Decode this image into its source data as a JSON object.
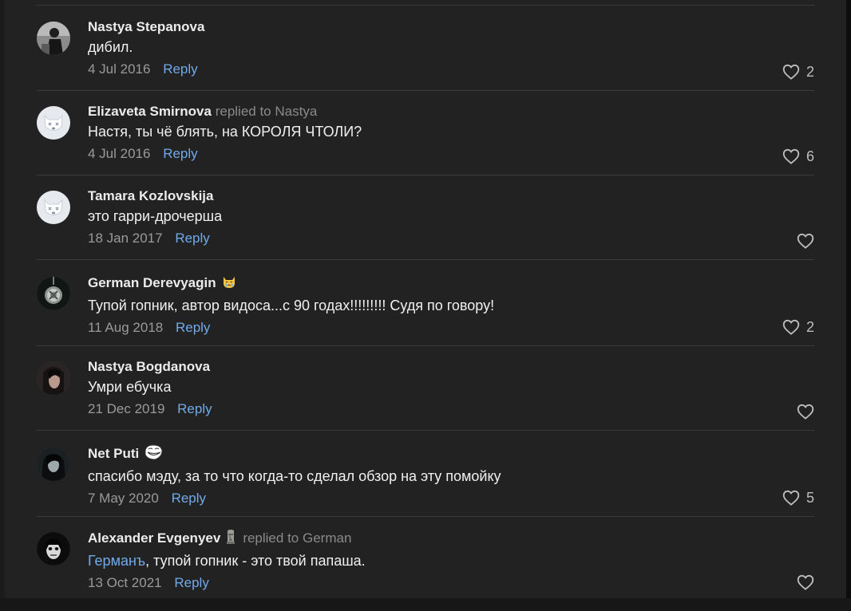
{
  "comments": [
    {
      "author": "Nastya Stepanova",
      "replied_label": "",
      "replied_to": "",
      "mention": "",
      "text": "дибил.",
      "date": "4 Jul 2016",
      "reply_label": "Reply",
      "likes": "2",
      "avatar_icon": "photo"
    },
    {
      "author": "Elizaveta Smirnova",
      "replied_label": "replied to",
      "replied_to": "Nastya",
      "mention": "",
      "text": "Настя, ты чё блять, на КОРОЛЯ ЧТОЛИ?",
      "date": "4 Jul 2016",
      "reply_label": "Reply",
      "likes": "6",
      "avatar_icon": "deactivated-dog"
    },
    {
      "author": "Tamara Kozlovskija",
      "replied_label": "",
      "replied_to": "",
      "mention": "",
      "text": "это гарри-дрочерша",
      "date": "18 Jan 2017",
      "reply_label": "Reply",
      "likes": "",
      "avatar_icon": "deactivated-dog"
    },
    {
      "author": "German Derevyagin",
      "replied_label": "",
      "replied_to": "",
      "mention": "",
      "text": "Тупой гопник, автор видоса...с 90 годах!!!!!!!!! Судя по говору!",
      "date": "11 Aug 2018",
      "reply_label": "Reply",
      "likes": "2",
      "avatar_icon": "pendant-photo",
      "badge": "crying-cat-emoji"
    },
    {
      "author": "Nastya Bogdanova",
      "replied_label": "",
      "replied_to": "",
      "mention": "",
      "text": "Умри ебучка",
      "date": "21 Dec 2019",
      "reply_label": "Reply",
      "likes": "",
      "avatar_icon": "photo"
    },
    {
      "author": "Net Puti",
      "replied_label": "",
      "replied_to": "",
      "mention": "",
      "text": "спасибо мэду, за то что когда-то сделал обзор на эту помойку",
      "date": "7 May 2020",
      "reply_label": "Reply",
      "likes": "5",
      "avatar_icon": "photo",
      "badge": "trollface-emoji"
    },
    {
      "author": "Alexander Evgenyev",
      "replied_label": "replied to",
      "replied_to": "German",
      "mention": "Германъ",
      "text": ", тупой гопник - это твой папаша.",
      "date": "13 Oct 2021",
      "reply_label": "Reply",
      "likes": "",
      "avatar_icon": "photo",
      "badge": "moai-emoji"
    }
  ],
  "colors": {
    "background": "#222222",
    "accent_link": "#71aaeb",
    "author_text": "#ececec",
    "meta_text": "#9a9a9a"
  }
}
